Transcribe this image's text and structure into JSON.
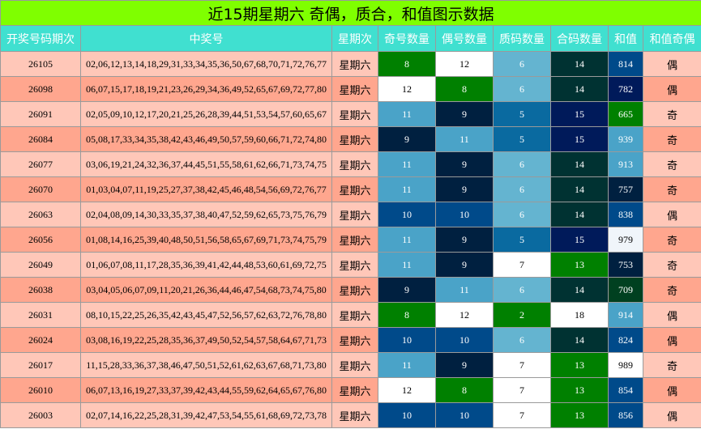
{
  "title": "近15期星期六 奇偶，质合，和值图示数据",
  "headers": [
    "开奖号码期次",
    "中奖号",
    "星期次",
    "奇号数量",
    "偶号数量",
    "质码数量",
    "合码数量",
    "和值",
    "和值奇偶"
  ],
  "colors": {
    "title_bg": "#7fff00",
    "header_bg": "#40e0d0",
    "row_light": "#ffc7b8",
    "row_dark": "#ffa68e"
  },
  "rows": [
    {
      "issue": "26105",
      "numbers": "02,06,12,13,14,18,29,31,33,34,35,36,50,67,68,70,71,72,76,77",
      "weekday": "星期六",
      "odd": "8",
      "even": "12",
      "prime": "6",
      "composite": "14",
      "sum": "814",
      "parity": "偶"
    },
    {
      "issue": "26098",
      "numbers": "06,07,15,17,18,19,21,23,26,29,34,36,49,52,65,67,69,72,77,80",
      "weekday": "星期六",
      "odd": "12",
      "even": "8",
      "prime": "6",
      "composite": "14",
      "sum": "782",
      "parity": "偶"
    },
    {
      "issue": "26091",
      "numbers": "02,05,09,10,12,17,20,21,25,26,28,39,44,51,53,54,57,60,65,67",
      "weekday": "星期六",
      "odd": "11",
      "even": "9",
      "prime": "5",
      "composite": "15",
      "sum": "665",
      "parity": "奇"
    },
    {
      "issue": "26084",
      "numbers": "05,08,17,33,34,35,38,42,43,46,49,50,57,59,60,66,71,72,74,80",
      "weekday": "星期六",
      "odd": "9",
      "even": "11",
      "prime": "5",
      "composite": "15",
      "sum": "939",
      "parity": "奇"
    },
    {
      "issue": "26077",
      "numbers": "03,06,19,21,24,32,36,37,44,45,51,55,58,61,62,66,71,73,74,75",
      "weekday": "星期六",
      "odd": "11",
      "even": "9",
      "prime": "6",
      "composite": "14",
      "sum": "913",
      "parity": "奇"
    },
    {
      "issue": "26070",
      "numbers": "01,03,04,07,11,19,25,27,37,38,42,45,46,48,54,56,69,72,76,77",
      "weekday": "星期六",
      "odd": "11",
      "even": "9",
      "prime": "6",
      "composite": "14",
      "sum": "757",
      "parity": "奇"
    },
    {
      "issue": "26063",
      "numbers": "02,04,08,09,14,30,33,35,37,38,40,47,52,59,62,65,73,75,76,79",
      "weekday": "星期六",
      "odd": "10",
      "even": "10",
      "prime": "6",
      "composite": "14",
      "sum": "838",
      "parity": "偶"
    },
    {
      "issue": "26056",
      "numbers": "01,08,14,16,25,39,40,48,50,51,56,58,65,67,69,71,73,74,75,79",
      "weekday": "星期六",
      "odd": "11",
      "even": "9",
      "prime": "5",
      "composite": "15",
      "sum": "979",
      "parity": "奇"
    },
    {
      "issue": "26049",
      "numbers": "01,06,07,08,11,17,28,35,36,39,41,42,44,48,53,60,61,69,72,75",
      "weekday": "星期六",
      "odd": "11",
      "even": "9",
      "prime": "7",
      "composite": "13",
      "sum": "753",
      "parity": "奇"
    },
    {
      "issue": "26038",
      "numbers": "03,04,05,06,07,09,11,20,21,26,36,44,46,47,54,68,73,74,75,80",
      "weekday": "星期六",
      "odd": "9",
      "even": "11",
      "prime": "6",
      "composite": "14",
      "sum": "709",
      "parity": "奇"
    },
    {
      "issue": "26031",
      "numbers": "08,10,15,22,25,26,35,42,43,45,47,52,56,57,62,63,72,76,78,80",
      "weekday": "星期六",
      "odd": "8",
      "even": "12",
      "prime": "2",
      "composite": "18",
      "sum": "914",
      "parity": "偶"
    },
    {
      "issue": "26024",
      "numbers": "03,08,16,19,22,25,28,35,36,37,49,50,52,54,57,58,64,67,71,73",
      "weekday": "星期六",
      "odd": "10",
      "even": "10",
      "prime": "6",
      "composite": "14",
      "sum": "824",
      "parity": "偶"
    },
    {
      "issue": "26017",
      "numbers": "11,15,28,33,36,37,38,46,47,50,51,52,61,62,63,67,68,71,73,80",
      "weekday": "星期六",
      "odd": "11",
      "even": "9",
      "prime": "7",
      "composite": "13",
      "sum": "989",
      "parity": "奇"
    },
    {
      "issue": "26010",
      "numbers": "06,07,13,16,19,27,33,37,39,42,43,44,55,59,62,64,65,67,76,80",
      "weekday": "星期六",
      "odd": "12",
      "even": "8",
      "prime": "7",
      "composite": "13",
      "sum": "854",
      "parity": "偶"
    },
    {
      "issue": "26003",
      "numbers": "02,07,14,16,22,25,28,31,39,42,47,53,54,55,61,68,69,72,73,78",
      "weekday": "星期六",
      "odd": "10",
      "even": "10",
      "prime": "7",
      "composite": "13",
      "sum": "856",
      "parity": "偶"
    }
  ],
  "cell_colors": {
    "odd": [
      "#008000",
      "#ffffff",
      "#4aa3c8",
      "#002040",
      "#4aa3c8",
      "#4aa3c8",
      "#004a8a",
      "#4aa3c8",
      "#4aa3c8",
      "#002040",
      "#008000",
      "#004a8a",
      "#4aa3c8",
      "#ffffff",
      "#004a8a"
    ],
    "even": [
      "#ffffff",
      "#008000",
      "#002040",
      "#4aa3c8",
      "#002040",
      "#002040",
      "#004a8a",
      "#002040",
      "#002040",
      "#4aa3c8",
      "#ffffff",
      "#004a8a",
      "#002040",
      "#008000",
      "#004a8a"
    ],
    "prime": [
      "#64b4d0",
      "#64b4d0",
      "#0a6aa0",
      "#0a6aa0",
      "#64b4d0",
      "#64b4d0",
      "#64b4d0",
      "#0a6aa0",
      "#ffffff",
      "#64b4d0",
      "#008000",
      "#64b4d0",
      "#ffffff",
      "#ffffff",
      "#ffffff"
    ],
    "composite": [
      "#003232",
      "#003232",
      "#001a5a",
      "#001a5a",
      "#003232",
      "#003232",
      "#003232",
      "#001a5a",
      "#008000",
      "#003232",
      "#ffffff",
      "#003232",
      "#008000",
      "#008000",
      "#008000"
    ],
    "sum": [
      "#004a8a",
      "#001a5a",
      "#008000",
      "#4aa3c8",
      "#4aa3c8",
      "#002040",
      "#004a8a",
      "#f0f5fa",
      "#002040",
      "#004020",
      "#4aa3c8",
      "#004a8a",
      "#ffffff",
      "#004a8a",
      "#004a8a"
    ]
  }
}
